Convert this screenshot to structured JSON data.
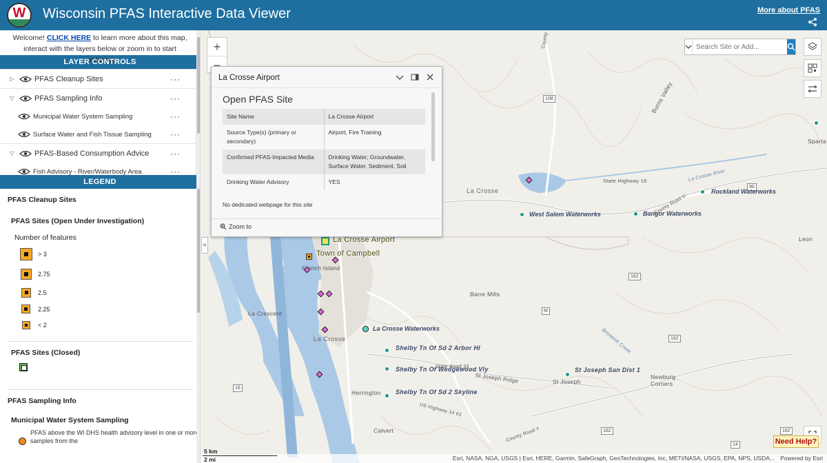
{
  "header": {
    "title": "Wisconsin PFAS Interactive Data Viewer",
    "more_link": "More about PFAS",
    "logo_letter": "W",
    "bg_color": "#1e6fa0"
  },
  "welcome": {
    "prefix": "Welcome! ",
    "link": "CLICK HERE",
    "suffix": " to learn more about this map, interact with the layers below or zoom in to start exploring."
  },
  "layer_controls": {
    "title": "LAYER CONTROLS",
    "items": [
      {
        "label": "PFAS Cleanup Sites",
        "expanded": false,
        "level": 0
      },
      {
        "label": "PFAS Sampling Info",
        "expanded": true,
        "level": 0
      },
      {
        "label": "Municipal Water System Sampling",
        "level": 1
      },
      {
        "label": "Surface Water and Fish Tissue Sampling",
        "level": 1
      },
      {
        "label": "PFAS-Based Consumption Advice",
        "expanded": true,
        "level": 0
      },
      {
        "label": "Fish Advisory - River/Waterbody Area",
        "level": 1
      }
    ]
  },
  "legend": {
    "title": "LEGEND",
    "cleanup_title": "PFAS Cleanup Sites",
    "open_title": "PFAS Sites (Open Under Investigation)",
    "num_features": "Number of features",
    "sizes": [
      "> 3",
      "2.75",
      "2.5",
      "2.25",
      "< 2"
    ],
    "closed_title": "PFAS Sites (Closed)",
    "sampling_title": "PFAS Sampling Info",
    "municipal_title": "Municipal Water System Sampling",
    "municipal_desc": "PFAS above the WI DHS health advisory level in one or more samples from the"
  },
  "search": {
    "placeholder": "Search Site or Add..."
  },
  "popup": {
    "title": "La Crosse Airport",
    "heading": "Open PFAS Site",
    "rows": [
      {
        "key": "Site Name",
        "value": "La Crosse Airport"
      },
      {
        "key": "Source Type(s) (primary or secondary)",
        "value": "Airport, Fire Training"
      },
      {
        "key": "Confirmed PFAS-Impacted Media",
        "value": "Drinking Water, Groundwater, Surface Water, Sediment, Soil"
      },
      {
        "key": "Drinking Water Advisory",
        "value": "YES"
      }
    ],
    "note": "No dedicated webpage for this site",
    "zoom_to": "Zoom to"
  },
  "map_labels": {
    "sparta": "Sparta",
    "la_crosse_upper": "La Crosse",
    "la_crosse": "La Crosse",
    "leon": "Leon",
    "barre_mills": "Barre Mills",
    "la_crescent": "La Crescent",
    "french_island": "French Island",
    "herrington": "Herrington",
    "calvert": "Calvert",
    "st_joseph": "St Joseph",
    "newburg_corners": "Newburg Corners",
    "burns_valley": "Burns Valley",
    "state_hwy_16": "State Highway 16",
    "la_crosse_river": "La Crosse River",
    "county_road_u": "County Road U",
    "state_road_33": "State Road 33",
    "st_joseph_ridge": "St Joseph Ridge",
    "us_hwy_14_61": "US Highway 14 61",
    "county_road_m": "County Road M",
    "bostwick_creek": "Bostwick Creek",
    "county_road_y": "County Road Y",
    "state_road": "State Road",
    "shields": [
      "108",
      "90",
      "162",
      "M",
      "162",
      "162",
      "16",
      "162",
      "14"
    ],
    "site_la_crosse_airport": "La Crosse Airport",
    "site_town_of_campbell": "Town of Campbell",
    "ww_rockland": "Rockland Waterworks",
    "ww_west_salem": "West Salem Waterworks",
    "ww_bangor": "Bangor Waterworks",
    "ww_la_crosse": "La Crosse Waterworks",
    "ww_shelby_arbor": "Shelby Tn Of Sd 2 Arbor Hl",
    "ww_shelby_wedgewood": "Shelby Tn Of Wedgewood Vly",
    "ww_shelby_skyline": "Shelby Tn Of Sd 2 Skyline",
    "ww_st_joseph": "St Joseph San Dist 1"
  },
  "scale": {
    "km": "5 km",
    "mi": "2 mi"
  },
  "attribution": "Esri, NASA, NGA, USGS | Esri, HERE, Garmin, SafeGraph, GeoTechnologies, Inc, METI/NASA, USGS, EPA, NPS, USDA...",
  "powered_by": "Powered by Esri",
  "help_button": "Need Help?",
  "icons": {
    "share": "share-icon",
    "layers": "layers-icon",
    "qr": "qr-icon",
    "compare": "compare-icon",
    "search": "search-icon",
    "fullscreen": "fullscreen-icon",
    "eye": "eye-icon"
  },
  "colors": {
    "accent": "#1e6fa0",
    "site_open": "#f7a823",
    "waterworks": "#1a9a86",
    "sampling": "#e06ad8",
    "water": "#aac9e6"
  }
}
